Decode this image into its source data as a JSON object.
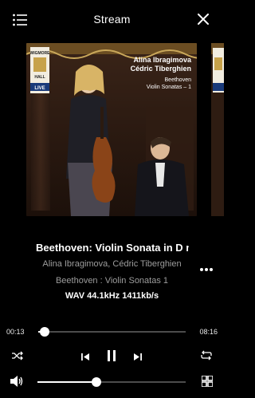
{
  "header": {
    "title": "Stream",
    "menu_icon": "menu-icon",
    "close_icon": "close-icon"
  },
  "album_art": {
    "label_badge_top": "WIGMORE",
    "label_badge_bottom": "HALL",
    "label_badge_live": "LIVE",
    "artist_line_1": "Alina Ibragimova",
    "artist_line_2": "Cédric Tiberghien",
    "composer": "Beethoven",
    "work": "Violin Sonatas – 1"
  },
  "track": {
    "title": "Beethoven: Violin Sonata in D m",
    "artists": "Alina Ibragimova, Cédric Tiberghien",
    "album": "Beethoven : Violin Sonatas 1",
    "quality": "WAV 44.1kHz 1411kb/s"
  },
  "playback": {
    "elapsed": "00:13",
    "duration": "08:16",
    "progress_fraction": 0.045
  },
  "volume": {
    "level_fraction": 0.4
  },
  "controls": {
    "shuffle_icon": "shuffle-icon",
    "previous_icon": "previous-icon",
    "pause_icon": "pause-icon",
    "next_icon": "next-icon",
    "repeat_icon": "repeat-icon",
    "volume_icon": "volume-icon",
    "grid_icon": "grid-icon",
    "more_icon": "more-icon"
  },
  "colors": {
    "background": "#000000",
    "text_primary": "#ffffff",
    "text_secondary": "#9d9d9d",
    "track_inactive": "#4c4c4c"
  }
}
